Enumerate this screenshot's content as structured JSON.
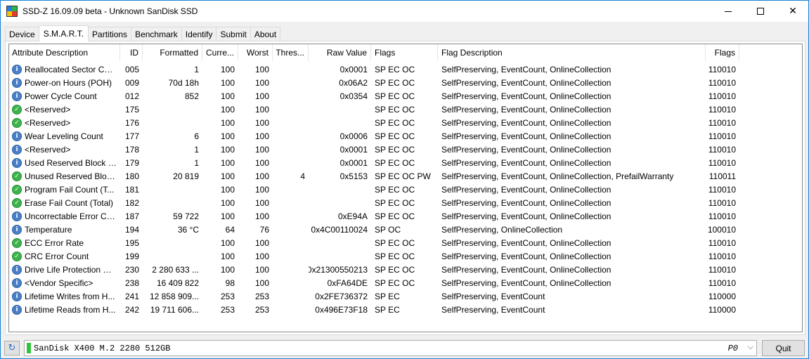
{
  "window": {
    "title": "SSD-Z 16.09.09 beta - Unknown SanDisk SSD",
    "minimize": "—",
    "maximize": "☐",
    "close": "✕"
  },
  "tabs": [
    {
      "label": "Device",
      "active": false
    },
    {
      "label": "S.M.A.R.T.",
      "active": true
    },
    {
      "label": "Partitions",
      "active": false
    },
    {
      "label": "Benchmark",
      "active": false
    },
    {
      "label": "Identify",
      "active": false
    },
    {
      "label": "Submit",
      "active": false
    },
    {
      "label": "About",
      "active": false
    }
  ],
  "smart": {
    "columns": [
      "Attribute Description",
      "ID",
      "Formatted",
      "Curre...",
      "Worst",
      "Thres...",
      "Raw Value",
      "Flags",
      "Flag Description",
      "Flags"
    ],
    "rows": [
      {
        "icon": "info-icon",
        "desc": "Reallocated Sector Cou...",
        "id": "005",
        "fmt": "1",
        "cur": "100",
        "worst": "100",
        "thr": "",
        "raw": "0x0001",
        "flags": "SP EC OC",
        "fdesc": "SelfPreserving, EventCount, OnlineCollection",
        "fl2": "110010"
      },
      {
        "icon": "info-icon",
        "desc": "Power-on Hours (POH)",
        "id": "009",
        "fmt": "70d 18h",
        "cur": "100",
        "worst": "100",
        "thr": "",
        "raw": "0x06A2",
        "flags": "SP EC OC",
        "fdesc": "SelfPreserving, EventCount, OnlineCollection",
        "fl2": "110010"
      },
      {
        "icon": "info-icon",
        "desc": "Power Cycle Count",
        "id": "012",
        "fmt": "852",
        "cur": "100",
        "worst": "100",
        "thr": "",
        "raw": "0x0354",
        "flags": "SP EC OC",
        "fdesc": "SelfPreserving, EventCount, OnlineCollection",
        "fl2": "110010"
      },
      {
        "icon": "ok-icon",
        "desc": "<Reserved>",
        "id": "175",
        "fmt": "",
        "cur": "100",
        "worst": "100",
        "thr": "",
        "raw": "",
        "flags": "SP EC OC",
        "fdesc": "SelfPreserving, EventCount, OnlineCollection",
        "fl2": "110010"
      },
      {
        "icon": "ok-icon",
        "desc": "<Reserved>",
        "id": "176",
        "fmt": "",
        "cur": "100",
        "worst": "100",
        "thr": "",
        "raw": "",
        "flags": "SP EC OC",
        "fdesc": "SelfPreserving, EventCount, OnlineCollection",
        "fl2": "110010"
      },
      {
        "icon": "info-icon",
        "desc": "Wear Leveling Count",
        "id": "177",
        "fmt": "6",
        "cur": "100",
        "worst": "100",
        "thr": "",
        "raw": "0x0006",
        "flags": "SP EC OC",
        "fdesc": "SelfPreserving, EventCount, OnlineCollection",
        "fl2": "110010"
      },
      {
        "icon": "info-icon",
        "desc": "<Reserved>",
        "id": "178",
        "fmt": "1",
        "cur": "100",
        "worst": "100",
        "thr": "",
        "raw": "0x0001",
        "flags": "SP EC OC",
        "fdesc": "SelfPreserving, EventCount, OnlineCollection",
        "fl2": "110010"
      },
      {
        "icon": "info-icon",
        "desc": "Used Reserved Block C...",
        "id": "179",
        "fmt": "1",
        "cur": "100",
        "worst": "100",
        "thr": "",
        "raw": "0x0001",
        "flags": "SP EC OC",
        "fdesc": "SelfPreserving, EventCount, OnlineCollection",
        "fl2": "110010"
      },
      {
        "icon": "ok-icon",
        "desc": "Unused Reserved Block...",
        "id": "180",
        "fmt": "20 819",
        "cur": "100",
        "worst": "100",
        "thr": "4",
        "raw": "0x5153",
        "flags": "SP EC OC PW",
        "fdesc": "SelfPreserving, EventCount, OnlineCollection, PrefailWarranty",
        "fl2": "110011"
      },
      {
        "icon": "ok-icon",
        "desc": "Program Fail Count (T...",
        "id": "181",
        "fmt": "",
        "cur": "100",
        "worst": "100",
        "thr": "",
        "raw": "",
        "flags": "SP EC OC",
        "fdesc": "SelfPreserving, EventCount, OnlineCollection",
        "fl2": "110010"
      },
      {
        "icon": "ok-icon",
        "desc": "Erase Fail Count (Total)",
        "id": "182",
        "fmt": "",
        "cur": "100",
        "worst": "100",
        "thr": "",
        "raw": "",
        "flags": "SP EC OC",
        "fdesc": "SelfPreserving, EventCount, OnlineCollection",
        "fl2": "110010"
      },
      {
        "icon": "info-icon",
        "desc": "Uncorrectable Error Co...",
        "id": "187",
        "fmt": "59 722",
        "cur": "100",
        "worst": "100",
        "thr": "",
        "raw": "0xE94A",
        "flags": "SP EC OC",
        "fdesc": "SelfPreserving, EventCount, OnlineCollection",
        "fl2": "110010"
      },
      {
        "icon": "info-icon",
        "desc": "Temperature",
        "id": "194",
        "fmt": "36 °C",
        "cur": "64",
        "worst": "76",
        "thr": "",
        "raw": "0x4C00110024",
        "flags": "SP OC",
        "fdesc": "SelfPreserving, OnlineCollection",
        "fl2": "100010"
      },
      {
        "icon": "ok-icon",
        "desc": "ECC Error Rate",
        "id": "195",
        "fmt": "",
        "cur": "100",
        "worst": "100",
        "thr": "",
        "raw": "",
        "flags": "SP EC OC",
        "fdesc": "SelfPreserving, EventCount, OnlineCollection",
        "fl2": "110010"
      },
      {
        "icon": "ok-icon",
        "desc": "CRC Error Count",
        "id": "199",
        "fmt": "",
        "cur": "100",
        "worst": "100",
        "thr": "",
        "raw": "",
        "flags": "SP EC OC",
        "fdesc": "SelfPreserving, EventCount, OnlineCollection",
        "fl2": "110010"
      },
      {
        "icon": "info-icon",
        "desc": "Drive Life Protection St...",
        "id": "230",
        "fmt": "2 280 633 ...",
        "cur": "100",
        "worst": "100",
        "thr": "",
        "raw": "0x21300550213",
        "flags": "SP EC OC",
        "fdesc": "SelfPreserving, EventCount, OnlineCollection",
        "fl2": "110010"
      },
      {
        "icon": "info-icon",
        "desc": "<Vendor Specific>",
        "id": "238",
        "fmt": "16 409 822",
        "cur": "98",
        "worst": "100",
        "thr": "",
        "raw": "0xFA64DE",
        "flags": "SP EC OC",
        "fdesc": "SelfPreserving, EventCount, OnlineCollection",
        "fl2": "110010"
      },
      {
        "icon": "info-icon",
        "desc": "Lifetime Writes from H...",
        "id": "241",
        "fmt": "12 858 909...",
        "cur": "253",
        "worst": "253",
        "thr": "",
        "raw": "0x2FE736372",
        "flags": "SP EC",
        "fdesc": "SelfPreserving, EventCount",
        "fl2": "110000"
      },
      {
        "icon": "info-icon",
        "desc": "Lifetime Reads from H...",
        "id": "242",
        "fmt": "19 711 606...",
        "cur": "253",
        "worst": "253",
        "thr": "",
        "raw": "0x496E73F18",
        "flags": "SP EC",
        "fdesc": "SelfPreserving, EventCount",
        "fl2": "110000"
      }
    ]
  },
  "bottom": {
    "refresh_icon": "refresh-icon",
    "drive_name": "SanDisk X400 M.2 2280 512GB",
    "drive_port": "P0",
    "dropdown_arrow": "⌵",
    "quit_label": "Quit"
  },
  "colors": {
    "accent_border": "#1883d7",
    "info_icon": "#4a80c8",
    "ok_icon": "#3cb44b",
    "drive_led": "#33c43c"
  }
}
